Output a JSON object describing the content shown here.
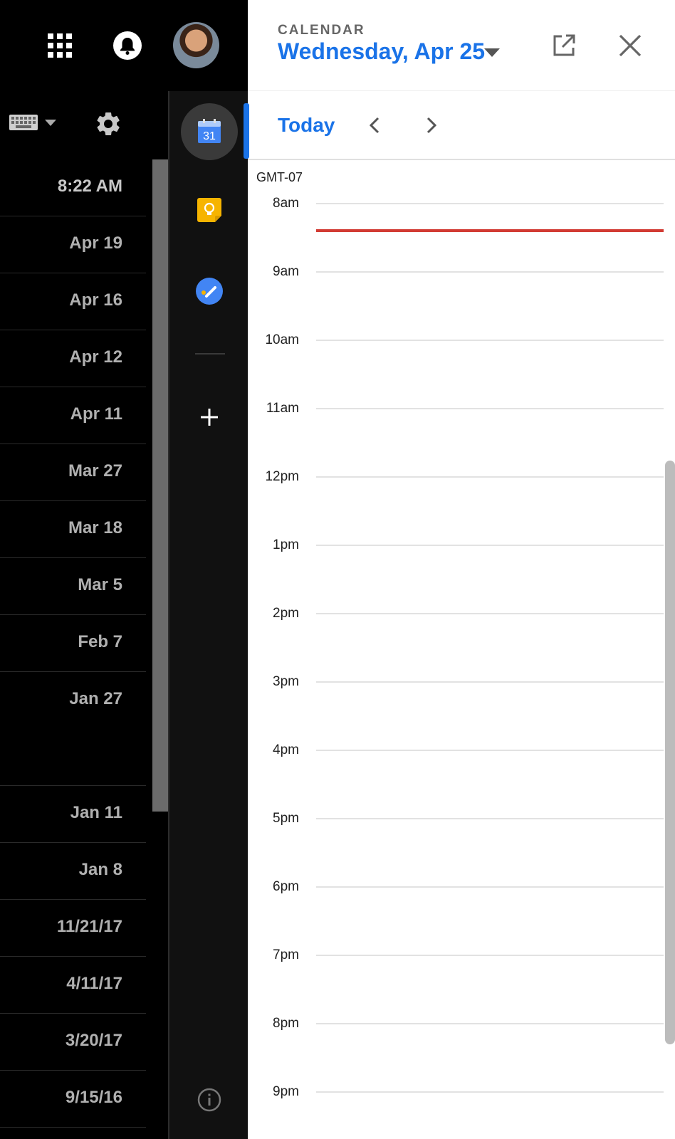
{
  "calendar": {
    "app_name": "CALENDAR",
    "date": "Wednesday, Apr 25",
    "today_label": "Today",
    "timezone": "GMT-07",
    "hours": [
      "8am",
      "9am",
      "10am",
      "11am",
      "12pm",
      "1pm",
      "2pm",
      "3pm",
      "4pm",
      "5pm",
      "6pm",
      "7pm",
      "8pm",
      "9pm"
    ],
    "calendar_icon_day": "31"
  },
  "mail_list": {
    "dates": [
      "8:22 AM",
      "Apr 19",
      "Apr 16",
      "Apr 12",
      "Apr 11",
      "Mar 27",
      "Mar 18",
      "Mar 5",
      "Feb 7",
      "Jan 27",
      "Jan 11",
      "Jan 8",
      "11/21/17",
      "4/11/17",
      "3/20/17",
      "9/15/16"
    ]
  },
  "colors": {
    "accent": "#1a73e8",
    "now_line": "#d23b33",
    "keep": "#f6b400",
    "tasks": "#4285f4"
  },
  "icons": [
    "apps-icon",
    "bell-icon",
    "keyboard-icon",
    "gear-icon",
    "calendar-icon",
    "keep-icon",
    "tasks-icon",
    "add-icon",
    "info-icon",
    "open-new-icon",
    "close-icon",
    "chevron-left-icon",
    "chevron-right-icon",
    "caret-down-icon"
  ]
}
